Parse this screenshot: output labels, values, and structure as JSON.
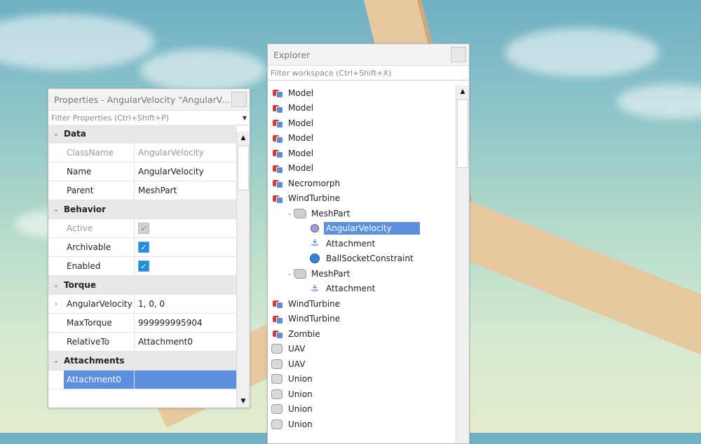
{
  "properties": {
    "title": "Properties - AngularVelocity \"AngularVeloci...",
    "filter_placeholder": "Filter Properties (Ctrl+Shift+P)",
    "rows": [
      {
        "kind": "category",
        "label": "Data"
      },
      {
        "kind": "prop",
        "name": "ClassName",
        "value": "AngularVelocity",
        "dim": true
      },
      {
        "kind": "prop",
        "name": "Name",
        "value": "AngularVelocity"
      },
      {
        "kind": "prop",
        "name": "Parent",
        "value": "MeshPart"
      },
      {
        "kind": "category",
        "label": "Behavior"
      },
      {
        "kind": "check",
        "name": "Active",
        "checked": true,
        "dim": true
      },
      {
        "kind": "check",
        "name": "Archivable",
        "checked": true
      },
      {
        "kind": "check",
        "name": "Enabled",
        "checked": true
      },
      {
        "kind": "category",
        "label": "Torque"
      },
      {
        "kind": "prop",
        "name": "AngularVelocity",
        "value": "1, 0, 0",
        "expandable": true
      },
      {
        "kind": "prop",
        "name": "MaxTorque",
        "value": "999999995904"
      },
      {
        "kind": "prop",
        "name": "RelativeTo",
        "value": "Attachment0"
      },
      {
        "kind": "category",
        "label": "Attachments"
      },
      {
        "kind": "prop",
        "name": "Attachment0",
        "value": "",
        "selected": true
      }
    ]
  },
  "explorer": {
    "title": "Explorer",
    "filter_placeholder": "Filter workspace (Ctrl+Shift+X)",
    "items": [
      {
        "label": "Model",
        "icon": "model-icon",
        "depth": 0
      },
      {
        "label": "Model",
        "icon": "model-icon",
        "depth": 0
      },
      {
        "label": "Model",
        "icon": "model-icon",
        "depth": 0
      },
      {
        "label": "Model",
        "icon": "model-icon",
        "depth": 0
      },
      {
        "label": "Model",
        "icon": "model-icon",
        "depth": 0
      },
      {
        "label": "Model",
        "icon": "model-icon",
        "depth": 0
      },
      {
        "label": "Necromorph",
        "icon": "model-icon",
        "depth": 0
      },
      {
        "label": "WindTurbine",
        "icon": "model-icon",
        "depth": 0
      },
      {
        "label": "MeshPart",
        "icon": "meshpart-icon",
        "depth": 1,
        "expanded": true
      },
      {
        "label": "AngularVelocity",
        "icon": "angular-velocity-icon",
        "depth": 2,
        "selected": true
      },
      {
        "label": "Attachment",
        "icon": "attachment-icon",
        "depth": 2
      },
      {
        "label": "BallSocketConstraint",
        "icon": "ball-socket-constraint-icon",
        "depth": 2
      },
      {
        "label": "MeshPart",
        "icon": "meshpart-icon",
        "depth": 1,
        "expanded": true
      },
      {
        "label": "Attachment",
        "icon": "attachment-icon",
        "depth": 2
      },
      {
        "label": "WindTurbine",
        "icon": "model-icon",
        "depth": 0
      },
      {
        "label": "WindTurbine",
        "icon": "model-icon",
        "depth": 0
      },
      {
        "label": "Zombie",
        "icon": "model-icon",
        "depth": 0
      },
      {
        "label": "UAV",
        "icon": "union-icon",
        "depth": 0
      },
      {
        "label": "UAV",
        "icon": "union-icon",
        "depth": 0
      },
      {
        "label": "Union",
        "icon": "union-icon",
        "depth": 0
      },
      {
        "label": "Union",
        "icon": "union-icon",
        "depth": 0
      },
      {
        "label": "Union",
        "icon": "union-icon",
        "depth": 0
      },
      {
        "label": "Union",
        "icon": "union-icon",
        "depth": 0
      }
    ]
  },
  "colors": {
    "selection": "#5c8fdd",
    "checkbox": "#1e8fe1",
    "category_bg": "#e8e8e8"
  }
}
